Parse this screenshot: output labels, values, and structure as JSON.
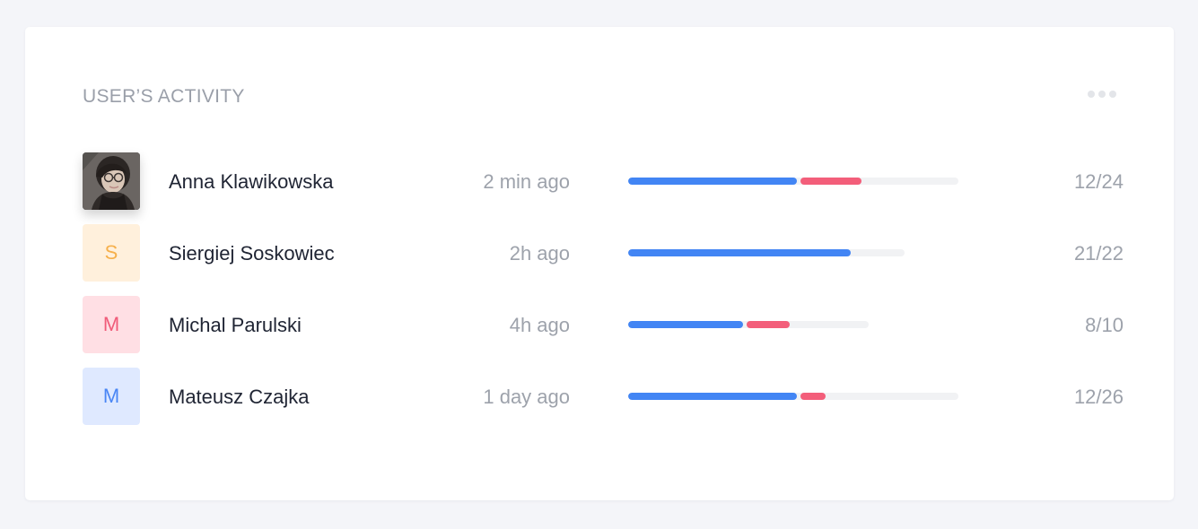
{
  "card": {
    "title": "USER’S ACTIVITY",
    "more_icon": "ellipsis-icon"
  },
  "colors": {
    "progress_primary": "#4285f4",
    "progress_secondary": "#f35e7a",
    "progress_track": "#f1f2f4"
  },
  "users": [
    {
      "name": "Anna Klawikowska",
      "time": "2 min ago",
      "score": "12/24",
      "avatar": {
        "type": "photo",
        "initial": ""
      },
      "progress": {
        "blue": 0.5,
        "red": 0.18,
        "track_scale": 1.0
      }
    },
    {
      "name": "Siergiej Soskowiec",
      "time": "2h ago",
      "score": "21/22",
      "avatar": {
        "type": "initial",
        "initial": "S",
        "bg": "#fff0dc",
        "fg": "#f6b04c"
      },
      "progress": {
        "blue": 0.8,
        "red": 0.0,
        "track_scale": 0.84
      }
    },
    {
      "name": "Michal Parulski",
      "time": "4h ago",
      "score": "8/10",
      "avatar": {
        "type": "initial",
        "initial": "M",
        "bg": "#ffdfe4",
        "fg": "#f05b79"
      },
      "progress": {
        "blue": 0.48,
        "red": 0.18,
        "track_scale": 0.73
      }
    },
    {
      "name": "Mateusz Czajka",
      "time": "1 day ago",
      "score": "12/26",
      "avatar": {
        "type": "initial",
        "initial": "M",
        "bg": "#dfe9ff",
        "fg": "#4a86f5"
      },
      "progress": {
        "blue": 0.5,
        "red": 0.08,
        "track_scale": 1.0
      }
    }
  ]
}
